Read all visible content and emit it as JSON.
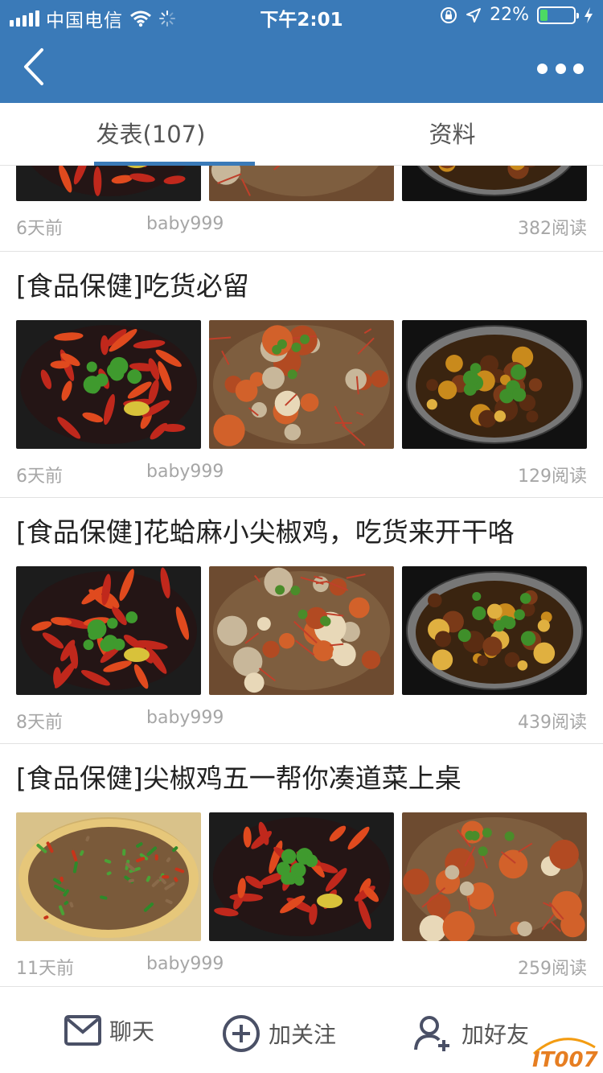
{
  "status_bar": {
    "carrier": "中国电信",
    "time": "下午2:01",
    "battery": "22%",
    "battery_level": 0.22
  },
  "tabs": [
    {
      "label": "发表(107)",
      "active": true
    },
    {
      "label": "资料",
      "active": false
    }
  ],
  "posts": [
    {
      "title": "",
      "date": "6天前",
      "author": "baby999",
      "reads": "382阅读",
      "thumbs": [
        "crawfish",
        "crab",
        "pot"
      ]
    },
    {
      "title": "[食品保健]吃货必留",
      "date": "6天前",
      "author": "baby999",
      "reads": "129阅读",
      "thumbs": [
        "crawfish",
        "crab",
        "pot"
      ]
    },
    {
      "title": "[食品保健]花蛤麻小尖椒鸡，吃货来开干咯",
      "date": "8天前",
      "author": "baby999",
      "reads": "439阅读",
      "thumbs": [
        "crawfish",
        "crab",
        "pot"
      ]
    },
    {
      "title": "[食品保健]尖椒鸡五一帮你凑道菜上桌",
      "date": "11天前",
      "author": "baby999",
      "reads": "259阅读",
      "thumbs": [
        "chicken",
        "crawfish",
        "crab"
      ]
    }
  ],
  "bottom_bar": {
    "chat": "聊天",
    "follow": "加关注",
    "add_friend": "加好友"
  },
  "watermark": "IT007",
  "colors": {
    "brand": "#3a7ab8",
    "battery": "#4cd964",
    "muted": "#a6a6a6"
  }
}
